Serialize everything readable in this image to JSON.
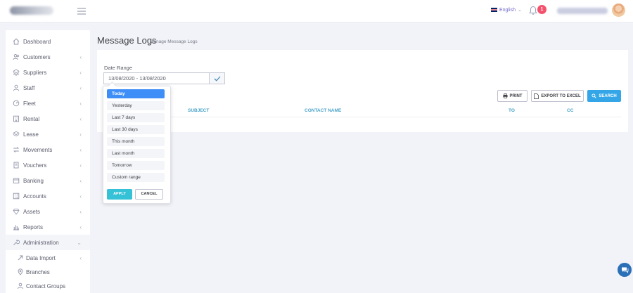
{
  "topbar": {
    "language": "English",
    "notification_count": "1"
  },
  "sidebar": {
    "items": [
      {
        "label": "Dashboard",
        "icon": "home-icon",
        "has_arrow": false
      },
      {
        "label": "Customers",
        "icon": "users-icon",
        "has_arrow": true
      },
      {
        "label": "Suppliers",
        "icon": "layers-icon",
        "has_arrow": true
      },
      {
        "label": "Staff",
        "icon": "staff-icon",
        "has_arrow": true
      },
      {
        "label": "Fleet",
        "icon": "gauge-icon",
        "has_arrow": true
      },
      {
        "label": "Rental",
        "icon": "building-icon",
        "has_arrow": true
      },
      {
        "label": "Lease",
        "icon": "stack-icon",
        "has_arrow": true
      },
      {
        "label": "Movements",
        "icon": "movements-icon",
        "has_arrow": true
      },
      {
        "label": "Vouchers",
        "icon": "voucher-icon",
        "has_arrow": true
      },
      {
        "label": "Banking",
        "icon": "bank-icon",
        "has_arrow": true
      },
      {
        "label": "Accounts",
        "icon": "calculator-icon",
        "has_arrow": true
      },
      {
        "label": "Assets",
        "icon": "diamond-icon",
        "has_arrow": true
      },
      {
        "label": "Reports",
        "icon": "bar-chart-icon",
        "has_arrow": true
      },
      {
        "label": "Administration",
        "icon": "wrench-icon",
        "has_arrow": true,
        "expanded": true
      }
    ],
    "subitems": [
      {
        "label": "Data Import",
        "icon": "import-icon",
        "has_arrow": true
      },
      {
        "label": "Branches",
        "icon": "map-pin-icon",
        "has_arrow": false
      },
      {
        "label": "Contact Groups",
        "icon": "group-icon",
        "has_arrow": false
      }
    ]
  },
  "page": {
    "title": "Message Logs",
    "subtitle": "Manage Message Logs"
  },
  "filter": {
    "label": "Date Range",
    "value": "13/08/2020 - 13/08/2020"
  },
  "buttons": {
    "print": "PRINT",
    "export": "EXPORT TO EXCEL",
    "search": "SEARCH"
  },
  "table": {
    "columns": [
      "SUBJECT",
      "CONTACT NAME",
      "TO",
      "CC"
    ]
  },
  "daterange": {
    "ranges": [
      "Today",
      "Yesterday",
      "Last 7 days",
      "Last 30 days",
      "This month",
      "Last month",
      "Tomorrow",
      "Custom range"
    ],
    "selected": "Today",
    "apply": "APPLY",
    "cancel": "CANCEL"
  },
  "colors": {
    "accent": "#34a6e8",
    "selected_range": "#3e8ef7",
    "apply": "#35c1d6",
    "badge": "#f4516c",
    "header_text": "#4aa3c9"
  }
}
